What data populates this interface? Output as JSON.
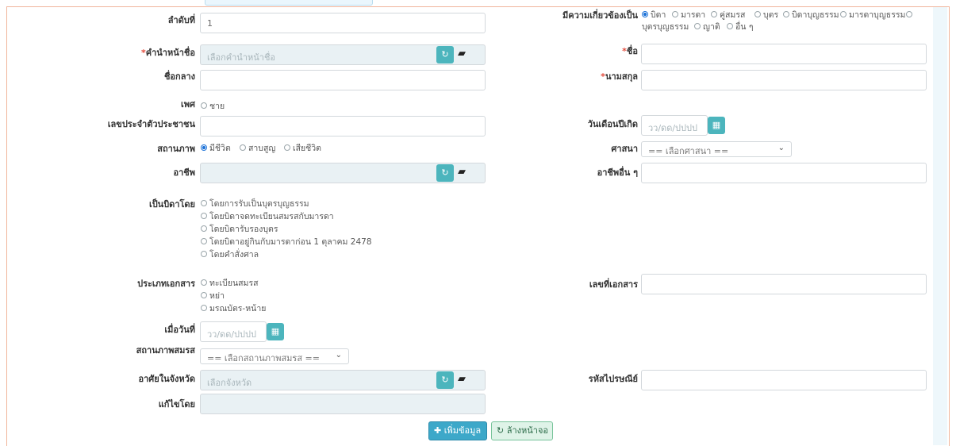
{
  "form": {
    "order_no_label": "ลำดับที่",
    "order_no_value": "1",
    "relation_label": "มีความเกี่ยวข้องเป็น",
    "relation_options": [
      "บิดา",
      "มารดา",
      "คู่สมรส",
      "บุตร",
      "บิดาบุญธรรม",
      "มารดาบุญธรรม",
      "บุตรบุญธรรม",
      "ญาติ",
      "อื่น ๆ"
    ],
    "prefix_label": "คำนำหน้าชื่อ",
    "prefix_placeholder": "เลือกคำนำหน้าชื่อ",
    "firstname_label": "ชื่อ",
    "middlename_label": "ชื่อกลาง",
    "lastname_label": "นามสกุล",
    "gender_label": "เพศ",
    "gender_options": [
      "ชาย"
    ],
    "idcard_label": "เลขประจำตัวประชาชน",
    "birthdate_label": "วันเดือนปีเกิด",
    "birthdate_placeholder": "วว/ดด/ปปปป",
    "status_label": "สถานภาพ",
    "status_options": [
      "มีชีวิต",
      "สาบสูญ",
      "เสียชีวิต"
    ],
    "religion_label": "ศาสนา",
    "religion_selected": "== เลือกศาสนา ==",
    "occupation_label": "อาชีพ",
    "other_occupation_label": "อาชีพอื่น ๆ",
    "father_by_label": "เป็นบิดาโดย",
    "father_by_options": [
      "โดยการรับเป็นบุตรบุญธรรม",
      "โดยบิดาจดทะเบียนสมรสกับมารดา",
      "โดยบิดารับรองบุตร",
      "โดยบิดาอยู่กินกับมารดาก่อน 1 ตุลาคม 2478",
      "โดยคำสั่งศาล"
    ],
    "doc_type_label": "ประเภทเอกสาร",
    "doc_type_options": [
      "ทะเบียนสมรส",
      "หย่า",
      "มรณบัตร-หน้าย"
    ],
    "doc_no_label": "เลขที่เอกสาร",
    "date_label": "เมื่อวันที่",
    "date_placeholder": "วว/ดด/ปปปป",
    "marital_label": "สถานภาพสมรส",
    "marital_selected": "== เลือกสถานภาพสมรส ==",
    "province_label": "อาศัยในจังหวัด",
    "province_placeholder": "เลือกจังหวัด",
    "postcode_label": "รหัสไปรษณีย์",
    "edited_by_label": "แก้ไขโดย",
    "add_button": "เพิ่มข้อมูล",
    "reset_button": "ล้างหน้าจอ"
  },
  "colors": {
    "accent": "#4cb5bd",
    "required": "#e34b3c",
    "panel_border": "#f0b59c"
  }
}
